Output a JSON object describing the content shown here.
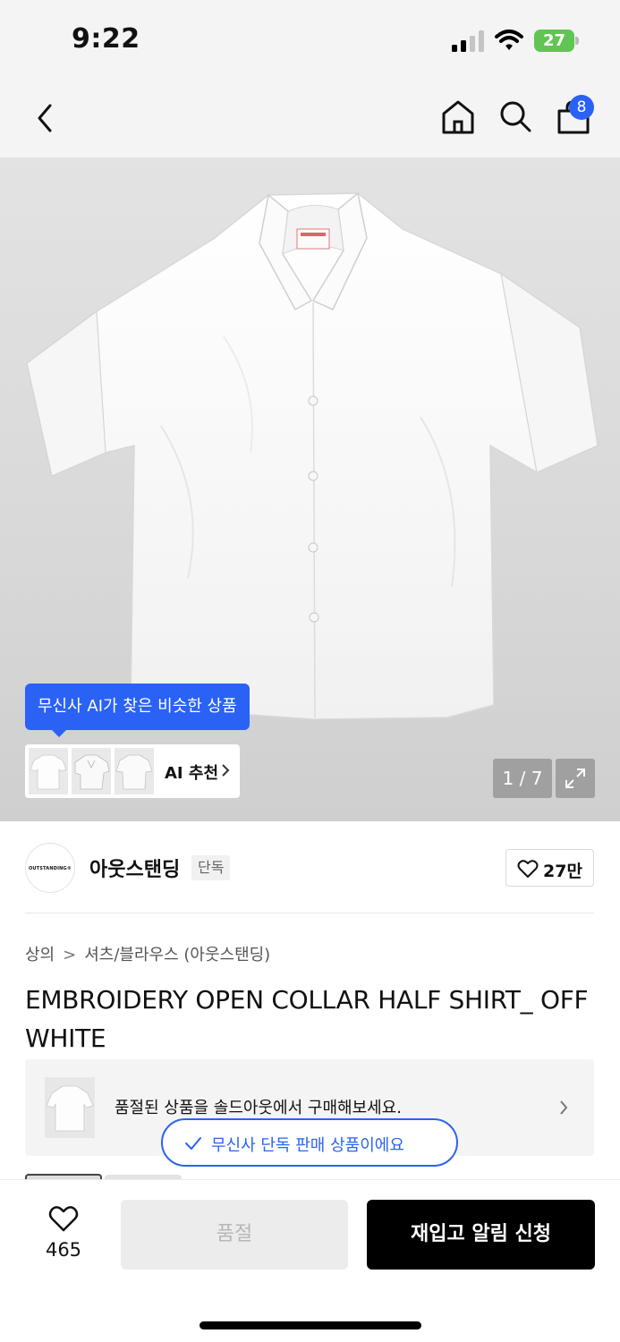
{
  "status_bar": {
    "time": "9:22",
    "battery": "27",
    "icons": [
      "signal-icon",
      "wifi-icon",
      "battery-icon"
    ]
  },
  "header": {
    "cart_count": "8",
    "icons": [
      "back-icon",
      "home-icon",
      "search-icon",
      "shopping-bag-icon"
    ]
  },
  "gallery": {
    "ai_tooltip": "무신사 AI가 찾은 비슷한 상품",
    "ai_label": "AI 추천",
    "pager": "1 / 7"
  },
  "brand": {
    "logo_text": "OUTSTANDING®",
    "name": "아웃스탠딩",
    "badge": "단독",
    "likes": "27만"
  },
  "breadcrumb": {
    "category": "상의",
    "subcategory": "셔츠/블라우스 (아웃스탠딩)"
  },
  "product": {
    "title": "EMBROIDERY OPEN COLLAR HALF SHIRT_ OFF WHITE"
  },
  "soldout_banner": {
    "text": "품절된 상품을 솔드아웃에서 구매해보세요."
  },
  "exclusive_pill": {
    "text": "무신사 단독 판매 상품이에요"
  },
  "bottom_bar": {
    "wish_count": "465",
    "soldout_label": "품절",
    "restock_label": "재입고 알림 신청"
  },
  "colors": {
    "accent": "#2a62f6",
    "battery": "#61c554",
    "primary_button": "#000000",
    "disabled_button": "#ececec"
  }
}
